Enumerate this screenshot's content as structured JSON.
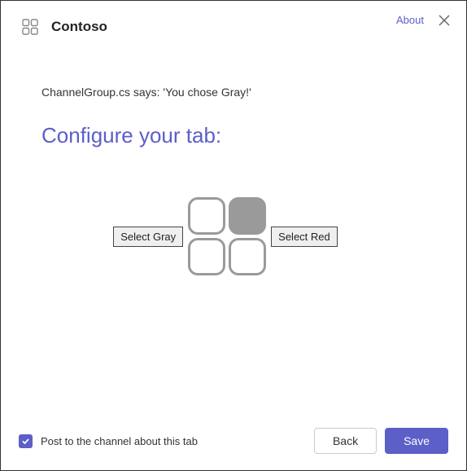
{
  "header": {
    "app_name": "Contoso",
    "about_label": "About"
  },
  "content": {
    "status_text": "ChannelGroup.cs says: 'You chose Gray!'",
    "heading": "Configure your tab:",
    "select_gray_label": "Select Gray",
    "select_red_label": "Select Red"
  },
  "footer": {
    "checkbox_label": "Post to the channel about this tab",
    "checkbox_checked": true,
    "back_label": "Back",
    "save_label": "Save"
  }
}
